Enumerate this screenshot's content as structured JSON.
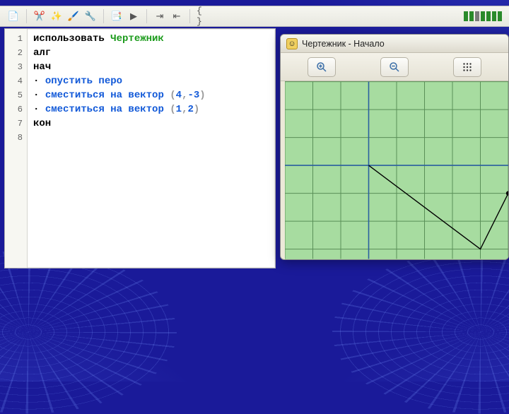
{
  "toolbar_icons": [
    "file",
    "scissors",
    "wand",
    "brush",
    "wrench",
    "layers",
    "play",
    "stop",
    "indent",
    "outdent",
    "hash1",
    "hash2",
    "paren",
    "brace"
  ],
  "editor": {
    "lines": [
      "1",
      "2",
      "3",
      "4",
      "5",
      "6",
      "7",
      "8"
    ],
    "code": {
      "l1_prefix": "использовать ",
      "l1_name": "Чертежник",
      "l2": "алг",
      "l3": "нач",
      "l4_dot": "· ",
      "l4_cmd": "опустить перо",
      "l5_dot": "· ",
      "l5_cmd": "сместиться на вектор",
      "l5_sp": " ",
      "l5_p1": "(",
      "l5_a": "4",
      "l5_c": ",",
      "l5_b": "-3",
      "l5_p2": ")",
      "l6_dot": "· ",
      "l6_cmd": "сместиться на вектор",
      "l6_sp": " ",
      "l6_p1": "(",
      "l6_a": "1",
      "l6_c": ",",
      "l6_b": "2",
      "l6_p2": ")",
      "l7": "кон"
    }
  },
  "draftsman": {
    "title": "Чертежник - Начало",
    "buttons": {
      "zoom_in": "zoom-in",
      "zoom_out": "zoom-out",
      "grid": "grid"
    },
    "grid": {
      "cell": 40,
      "origin_col": 3,
      "origin_row": 3,
      "path": [
        [
          0,
          0
        ],
        [
          4,
          -3
        ],
        [
          5,
          -1
        ]
      ],
      "pen_at": [
        5,
        -1
      ]
    }
  }
}
